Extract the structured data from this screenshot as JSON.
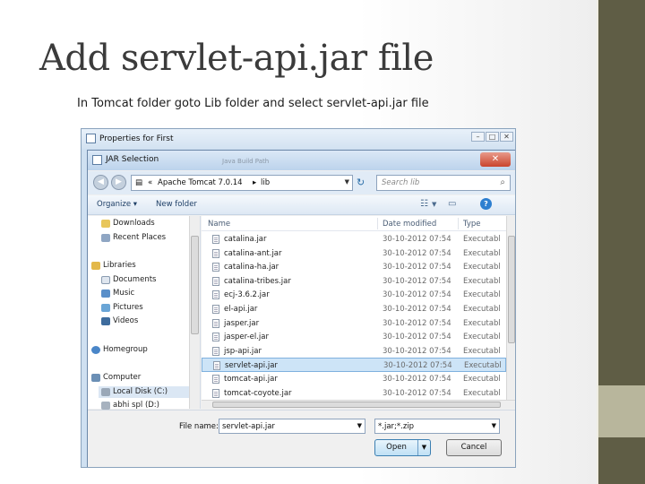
{
  "slide": {
    "title": "Add servlet-api.jar file",
    "subtitle": "In Tomcat folder goto Lib folder and select servlet-api.jar file",
    "colors": {
      "right_band": "#5f5d45",
      "right_block": "#b8b69c",
      "title_text": "#3b3b3b"
    }
  },
  "outer_window": {
    "title": "Properties for First",
    "controls": [
      "–",
      "□",
      "✕"
    ]
  },
  "dialog": {
    "title": "JAR Selection",
    "background_title": "Java Build Path",
    "close_label": "✕",
    "address": {
      "prefix": "«",
      "segments": [
        "Apache Tomcat 7.0.14",
        "lib"
      ]
    },
    "search_placeholder": "Search lib",
    "toolbar": {
      "organize": "Organize ▾",
      "new_folder": "New folder",
      "help": "?"
    },
    "nav_items": [
      {
        "label": "Downloads",
        "icon": "downloads-folder-icon"
      },
      {
        "label": "Recent Places",
        "icon": "recent-places-icon"
      },
      {
        "label": "Libraries",
        "icon": "libraries-icon"
      },
      {
        "label": "Documents",
        "icon": "documents-icon"
      },
      {
        "label": "Music",
        "icon": "music-icon"
      },
      {
        "label": "Pictures",
        "icon": "pictures-icon"
      },
      {
        "label": "Videos",
        "icon": "videos-icon"
      },
      {
        "label": "Homegroup",
        "icon": "homegroup-icon"
      },
      {
        "label": "Computer",
        "icon": "computer-icon"
      },
      {
        "label": "Local Disk (C:)",
        "icon": "local-disk-icon"
      },
      {
        "label": "abhi spl (D:)",
        "icon": "drive-icon"
      }
    ],
    "columns": {
      "name": "Name",
      "date": "Date modified",
      "type": "Type"
    },
    "files": [
      {
        "name": "catalina.jar",
        "date": "30-10-2012 07:54",
        "type": "Executabl"
      },
      {
        "name": "catalina-ant.jar",
        "date": "30-10-2012 07:54",
        "type": "Executabl"
      },
      {
        "name": "catalina-ha.jar",
        "date": "30-10-2012 07:54",
        "type": "Executabl"
      },
      {
        "name": "catalina-tribes.jar",
        "date": "30-10-2012 07:54",
        "type": "Executabl"
      },
      {
        "name": "ecj-3.6.2.jar",
        "date": "30-10-2012 07:54",
        "type": "Executabl"
      },
      {
        "name": "el-api.jar",
        "date": "30-10-2012 07:54",
        "type": "Executabl"
      },
      {
        "name": "jasper.jar",
        "date": "30-10-2012 07:54",
        "type": "Executabl"
      },
      {
        "name": "jasper-el.jar",
        "date": "30-10-2012 07:54",
        "type": "Executabl"
      },
      {
        "name": "jsp-api.jar",
        "date": "30-10-2012 07:54",
        "type": "Executabl"
      },
      {
        "name": "servlet-api.jar",
        "date": "30-10-2012 07:54",
        "type": "Executabl",
        "selected": true
      },
      {
        "name": "tomcat-api.jar",
        "date": "30-10-2012 07:54",
        "type": "Executabl"
      },
      {
        "name": "tomcat-coyote.jar",
        "date": "30-10-2012 07:54",
        "type": "Executabl"
      }
    ],
    "file_name_label": "File name:",
    "file_name_value": "servlet-api.jar",
    "filter_value": "*.jar;*.zip",
    "open_label": "Open",
    "cancel_label": "Cancel"
  }
}
